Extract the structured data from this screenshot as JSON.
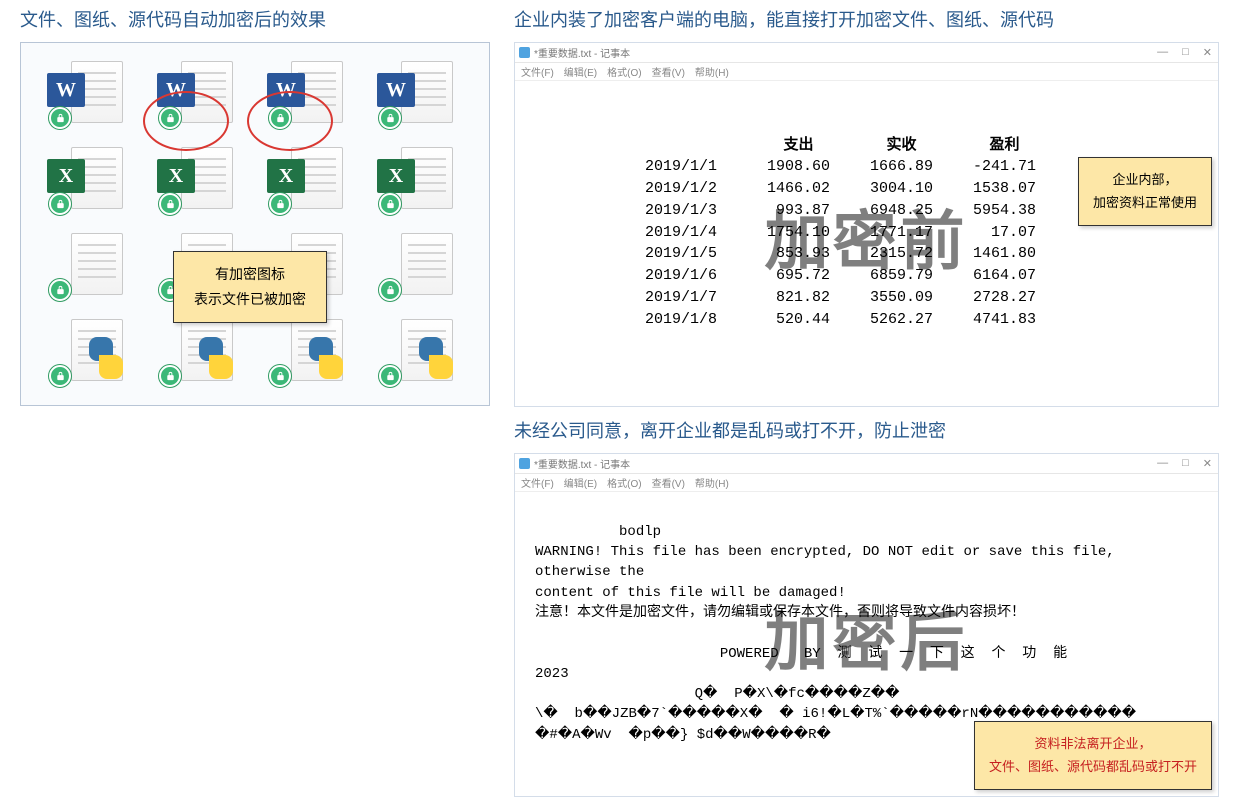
{
  "left": {
    "heading": "文件、图纸、源代码自动加密后的效果",
    "callout_l1": "有加密图标",
    "callout_l2": "表示文件已被加密"
  },
  "right1": {
    "heading": "企业内装了加密客户端的电脑，能直接打开加密文件、图纸、源代码",
    "np_title": "*重要数据.txt - 记事本",
    "menu": [
      "文件(F)",
      "编辑(E)",
      "格式(O)",
      "查看(V)",
      "帮助(H)"
    ],
    "watermark": "加密前",
    "callout_l1": "企业内部，",
    "callout_l2": "加密资料正常使用",
    "table_headers": [
      "支出",
      "实收",
      "盈利"
    ],
    "rows": [
      {
        "d": "2019/1/1",
        "a": "1908.60",
        "b": "1666.89",
        "c": "-241.71"
      },
      {
        "d": "2019/1/2",
        "a": "1466.02",
        "b": "3004.10",
        "c": "1538.07"
      },
      {
        "d": "2019/1/3",
        "a": "993.87",
        "b": "6948.25",
        "c": "5954.38"
      },
      {
        "d": "2019/1/4",
        "a": "1754.10",
        "b": "1771.17",
        "c": "17.07"
      },
      {
        "d": "2019/1/5",
        "a": "853.93",
        "b": "2315.72",
        "c": "1461.80"
      },
      {
        "d": "2019/1/6",
        "a": "695.72",
        "b": "6859.79",
        "c": "6164.07"
      },
      {
        "d": "2019/1/7",
        "a": "821.82",
        "b": "3550.09",
        "c": "2728.27"
      },
      {
        "d": "2019/1/8",
        "a": "520.44",
        "b": "5262.27",
        "c": "4741.83"
      }
    ]
  },
  "right2": {
    "heading": "未经公司同意，离开企业都是乱码或打不开，防止泄密",
    "np_title": "*重要数据.txt - 记事本",
    "menu": [
      "文件(F)",
      "编辑(E)",
      "格式(O)",
      "查看(V)",
      "帮助(H)"
    ],
    "watermark": "加密后",
    "body": "bodlp\nWARNING! This file has been encrypted, DO NOT edit or save this file, otherwise the\ncontent of this file will be damaged!\n注意！本文件是加密文件，请勿编辑或保存本文件，否则将导致文件内容损坏！\n\n                      POWERED   BY  测  试  一  下  这  个  功  能\n2023\n                   Q�  P�X\\�fc����Z��\n\\�  b��JZB�7`�����X�  � i6!�L�T%`�����rN�����������\n�#�A�Wv  �p��} $d��W����R�",
    "callout_l1": "资料非法离开企业，",
    "callout_l2": "文件、图纸、源代码都乱码或打不开"
  },
  "icons": {
    "word": "W",
    "excel": "X"
  }
}
